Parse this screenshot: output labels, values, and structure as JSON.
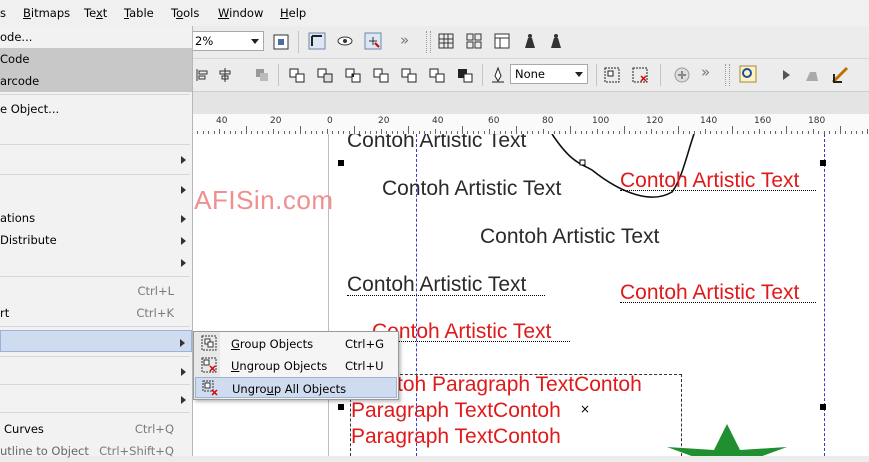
{
  "menubar": {
    "items": [
      "s",
      "Bitmaps",
      "Text",
      "Table",
      "Tools",
      "Window",
      "Help"
    ],
    "underlines": [
      "",
      "B",
      "x",
      "T",
      "o",
      "W",
      "H"
    ]
  },
  "toolbar": {
    "zoom_value": "2%",
    "outline_value": "None"
  },
  "ruler": {
    "labels": [
      "40",
      "20",
      "0",
      "20",
      "40",
      "60",
      "80",
      "100",
      "120",
      "140",
      "160",
      "180"
    ]
  },
  "left_menu": {
    "items": [
      {
        "label": "ode...",
        "shortcut": "",
        "submenu": false
      },
      {
        "label": "Code",
        "shortcut": "",
        "submenu": false
      },
      {
        "label": "arcode",
        "shortcut": "",
        "submenu": false
      },
      {
        "label": "e Object...",
        "shortcut": "",
        "submenu": false
      },
      {
        "label": "",
        "shortcut": "",
        "submenu": true
      },
      {
        "label": "",
        "shortcut": "",
        "submenu": true
      },
      {
        "label": "ations",
        "shortcut": "",
        "submenu": true
      },
      {
        "label": "Distribute",
        "shortcut": "",
        "submenu": true
      },
      {
        "label": "",
        "shortcut": "",
        "submenu": true
      },
      {
        "label": "",
        "shortcut": "Ctrl+L",
        "submenu": false
      },
      {
        "label": "rt",
        "shortcut": "Ctrl+K",
        "submenu": false
      },
      {
        "label": "",
        "shortcut": "",
        "submenu": true
      },
      {
        "label": "",
        "shortcut": "",
        "submenu": true
      },
      {
        "label": "",
        "shortcut": "",
        "submenu": true
      },
      {
        "label": "Curves",
        "shortcut": "Ctrl+Q",
        "submenu": false
      },
      {
        "label": "utline to Object",
        "shortcut": "Ctrl+Shift+Q",
        "submenu": false
      }
    ]
  },
  "submenu": {
    "items": [
      {
        "label": "Group Objects",
        "underline": "G",
        "shortcut": "Ctrl+G"
      },
      {
        "label": "Ungroup Objects",
        "underline": "U",
        "shortcut": "Ctrl+U"
      },
      {
        "label": "Ungroup All Objects",
        "underline": "U",
        "shortcut": ""
      }
    ]
  },
  "canvas": {
    "watermark": "www.GRAFISin.com",
    "artistic_text": "Contoh Artistic Text",
    "paragraph_lines": [
      "toh Paragraph TextContoh",
      "Paragraph TextContoh",
      "Paragraph TextContoh"
    ]
  },
  "colors": {
    "red_text": "#e01a1a",
    "watermark": "#ef8f8f",
    "menu_highlight": "#cfdcef",
    "star_green": "#1f8f2f"
  }
}
